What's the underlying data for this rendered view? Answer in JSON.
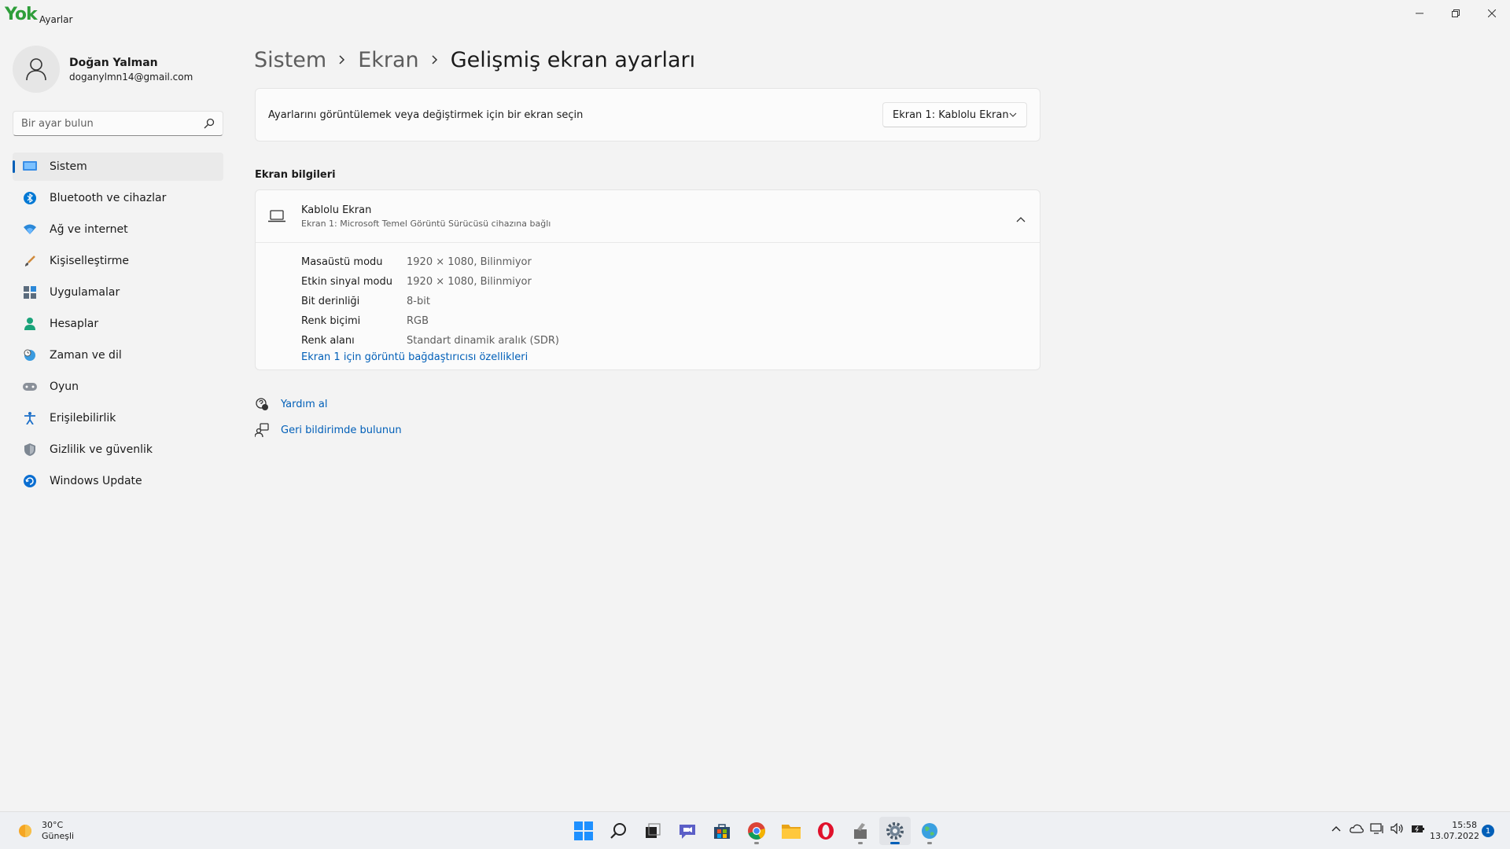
{
  "app": {
    "logo": "Yok",
    "title": "Ayarlar"
  },
  "profile": {
    "name": "Doğan Yalman",
    "email": "doganylmn14@gmail.com"
  },
  "search": {
    "placeholder": "Bir ayar bulun"
  },
  "sidebar": {
    "items": [
      {
        "label": "Sistem",
        "icon": "system-icon",
        "active": true
      },
      {
        "label": "Bluetooth ve cihazlar",
        "icon": "bluetooth-icon"
      },
      {
        "label": "Ağ ve internet",
        "icon": "wifi-icon"
      },
      {
        "label": "Kişiselleştirme",
        "icon": "brush-icon"
      },
      {
        "label": "Uygulamalar",
        "icon": "apps-icon"
      },
      {
        "label": "Hesaplar",
        "icon": "account-icon"
      },
      {
        "label": "Zaman ve dil",
        "icon": "globe-clock-icon"
      },
      {
        "label": "Oyun",
        "icon": "gamepad-icon"
      },
      {
        "label": "Erişilebilirlik",
        "icon": "accessibility-icon"
      },
      {
        "label": "Gizlilik ve güvenlik",
        "icon": "shield-icon"
      },
      {
        "label": "Windows Update",
        "icon": "update-icon"
      }
    ]
  },
  "breadcrumb": {
    "level1": "Sistem",
    "level2": "Ekran",
    "current": "Gelişmiş ekran ayarları"
  },
  "display_select": {
    "label": "Ayarlarını görüntülemek veya değiştirmek için bir ekran seçin",
    "value": "Ekran 1: Kablolu Ekran"
  },
  "display_info": {
    "section_title": "Ekran bilgileri",
    "title": "Kablolu Ekran",
    "subtitle": "Ekran 1: Microsoft Temel Görüntü Sürücüsü cihazına bağlı",
    "rows": [
      {
        "key": "Masaüstü modu",
        "value": "1920 × 1080, Bilinmiyor"
      },
      {
        "key": "Etkin sinyal modu",
        "value": "1920 × 1080, Bilinmiyor"
      },
      {
        "key": "Bit derinliği",
        "value": "8-bit"
      },
      {
        "key": "Renk biçimi",
        "value": "RGB"
      },
      {
        "key": "Renk alanı",
        "value": "Standart dinamik aralık (SDR)"
      }
    ],
    "link": "Ekran 1 için görüntü bağdaştırıcısı özellikleri"
  },
  "help": {
    "get_help": "Yardım al",
    "feedback": "Geri bildirimde bulunun"
  },
  "taskbar": {
    "weather_temp": "30°C",
    "weather_desc": "Güneşli",
    "time": "15:58",
    "date": "13.07.2022",
    "notifications": "1"
  },
  "colors": {
    "accent": "#005fb8",
    "background": "#f3f3f3",
    "card": "#fbfbfb"
  }
}
